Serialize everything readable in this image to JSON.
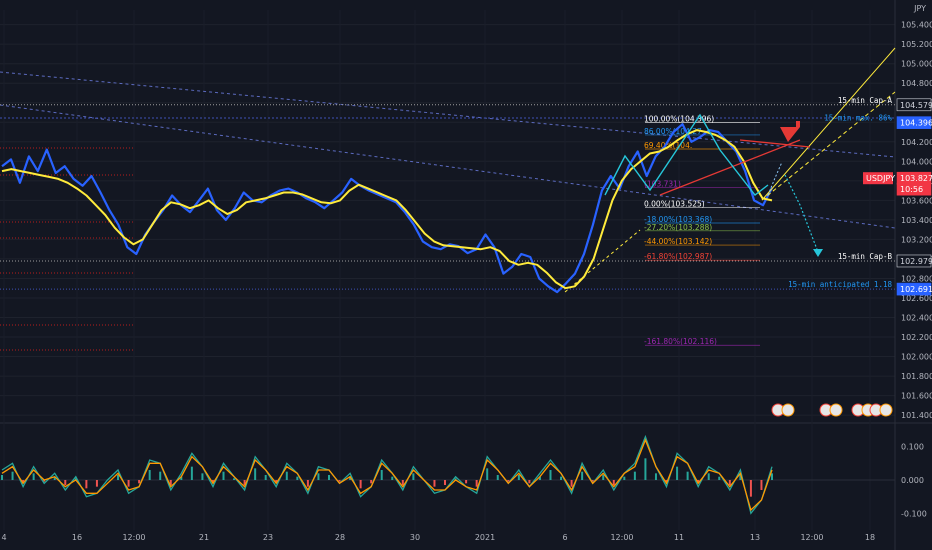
{
  "currency": "JPY",
  "colors": {
    "background": "#131722",
    "price_line": "#2962ff",
    "ma_line": "#ffeb3b",
    "fib_line": "#ffffff",
    "cap_line": "#ffeb3b",
    "arrow": "#e53935",
    "pattern": "#26c6da",
    "osc_a": "#26a69a",
    "osc_b": "#ff9800",
    "hist_pos": "#26a69a",
    "hist_neg": "#ef5350"
  },
  "price_tags": [
    {
      "label": "104.579",
      "value": 104.579,
      "bg": "#131722",
      "fg": "#d1d4dc"
    },
    {
      "label": "104.396",
      "value": 104.396,
      "bg": "#2962ff",
      "fg": "#ffffff"
    },
    {
      "label": "103.827",
      "value": 103.827,
      "bg": "#f23645",
      "fg": "#ffffff"
    },
    {
      "label": "10:56",
      "value": 103.7,
      "bg": "#f23645",
      "fg": "#ffffff"
    },
    {
      "label": "102.979",
      "value": 102.979,
      "bg": "#131722",
      "fg": "#d1d4dc"
    },
    {
      "label": "102.691",
      "value": 102.691,
      "bg": "#2962ff",
      "fg": "#ffffff"
    }
  ],
  "symbol_tag": "USDJPY",
  "annotations": [
    {
      "text": "15-min Cap-A",
      "value": 104.579,
      "color": "#ffffff"
    },
    {
      "text": "15-min max. 86%",
      "value": 104.396,
      "color": "#2196f3"
    },
    {
      "text": "15-min Cap-B",
      "value": 102.979,
      "color": "#ffffff"
    },
    {
      "text": "15-min anticipated 1.18",
      "value": 102.691,
      "color": "#2196f3"
    }
  ],
  "fib_levels": [
    {
      "label": "100.00%(104.396)",
      "value": 104.396,
      "color": "#ffffff"
    },
    {
      "label": "86.00%(104.27",
      "value": 104.27,
      "color": "#2196f3"
    },
    {
      "label": "69.40%(104.",
      "value": 104.126,
      "color": "#ff9800"
    },
    {
      "label": "(103.731)",
      "value": 103.731,
      "color": "#9c27b0"
    },
    {
      "label": "0.00%(103.525)",
      "value": 103.525,
      "color": "#ffffff"
    },
    {
      "label": "-18.00%(103.368)",
      "value": 103.368,
      "color": "#2196f3"
    },
    {
      "label": "-27.20%(103.288)",
      "value": 103.288,
      "color": "#8bc34a"
    },
    {
      "label": "-44.00%(103.142)",
      "value": 103.142,
      "color": "#ff9800"
    },
    {
      "label": "-61.80%(102.987)",
      "value": 102.987,
      "color": "#f44336"
    },
    {
      "label": "-161.80%(102.116)",
      "value": 102.116,
      "color": "#9c27b0"
    }
  ],
  "chart_data": [
    {
      "type": "line",
      "title": "",
      "xlabel": "",
      "ylabel": "",
      "x_ticks": [
        "4",
        "16",
        "12:00",
        "21",
        "23",
        "28",
        "30",
        "2021",
        "6",
        "12:00",
        "11",
        "13",
        "12:00",
        "18"
      ],
      "y_ticks": [
        "105.400",
        "105.200",
        "105.000",
        "104.800",
        "104.600",
        "104.400",
        "104.200",
        "104.000",
        "103.800",
        "103.600",
        "103.400",
        "103.200",
        "103.000",
        "102.800",
        "102.600",
        "102.400",
        "102.200",
        "102.000",
        "101.800",
        "101.600",
        "101.400"
      ],
      "ylim": [
        101.35,
        105.55
      ],
      "grid": true,
      "series": [
        {
          "values": [
            103.95,
            104.02,
            103.78,
            104.05,
            103.9,
            104.12,
            103.88,
            103.95,
            103.82,
            103.75,
            103.85,
            103.68,
            103.5,
            103.35,
            103.12,
            103.05,
            103.25,
            103.38,
            103.5,
            103.65,
            103.55,
            103.48,
            103.6,
            103.72,
            103.5,
            103.4,
            103.52,
            103.68,
            103.6,
            103.58,
            103.65,
            103.7,
            103.72,
            103.68,
            103.62,
            103.58,
            103.52,
            103.6,
            103.68,
            103.82,
            103.75,
            103.7,
            103.66,
            103.62,
            103.58,
            103.48,
            103.35,
            103.18,
            103.12,
            103.1,
            103.15,
            103.13,
            103.06,
            103.1,
            103.25,
            103.12,
            102.85,
            102.92,
            103.05,
            103.02,
            102.8,
            102.72,
            102.66,
            102.75,
            102.85,
            103.05,
            103.35,
            103.7,
            103.85,
            103.72,
            103.95,
            104.1,
            103.85,
            104.05,
            104.15,
            104.3,
            104.38,
            104.2,
            104.25,
            104.32,
            104.3,
            104.2,
            104.1,
            103.9,
            103.6,
            103.55,
            103.73
          ]
        },
        {
          "values": [
            103.9,
            103.92,
            103.9,
            103.88,
            103.86,
            103.84,
            103.82,
            103.78,
            103.72,
            103.65,
            103.55,
            103.45,
            103.32,
            103.22,
            103.15,
            103.2,
            103.35,
            103.5,
            103.58,
            103.56,
            103.52,
            103.55,
            103.6,
            103.52,
            103.46,
            103.5,
            103.58,
            103.6,
            103.62,
            103.65,
            103.68,
            103.68,
            103.66,
            103.62,
            103.58,
            103.57,
            103.6,
            103.7,
            103.76,
            103.72,
            103.68,
            103.64,
            103.6,
            103.5,
            103.38,
            103.26,
            103.18,
            103.14,
            103.13,
            103.12,
            103.11,
            103.1,
            103.12,
            103.08,
            102.98,
            102.94,
            102.96,
            102.94,
            102.86,
            102.76,
            102.7,
            102.72,
            102.82,
            103.0,
            103.3,
            103.6,
            103.8,
            103.92,
            104.0,
            104.08,
            104.1,
            104.15,
            104.22,
            104.28,
            104.32,
            104.3,
            104.27,
            104.22,
            104.15,
            104.0,
            103.78,
            103.62,
            103.6
          ]
        }
      ]
    },
    {
      "type": "line",
      "title": "",
      "y_ticks": [
        "0.100",
        "0.000",
        "-0.100"
      ],
      "ylim": [
        -0.15,
        0.15
      ],
      "series": [
        {
          "values": [
            0.03,
            0.05,
            -0.02,
            0.04,
            -0.01,
            0.02,
            -0.03,
            0.01,
            -0.05,
            -0.04,
            0.0,
            0.03,
            -0.04,
            -0.02,
            0.06,
            0.05,
            -0.03,
            0.02,
            0.08,
            0.04,
            -0.02,
            0.05,
            0.01,
            -0.03,
            0.07,
            0.03,
            -0.02,
            0.05,
            0.02,
            -0.04,
            0.04,
            0.03,
            -0.01,
            0.02,
            -0.05,
            -0.02,
            0.06,
            0.02,
            -0.03,
            0.04,
            0.0,
            -0.04,
            -0.03,
            0.01,
            -0.02,
            -0.04,
            0.07,
            0.03,
            -0.01,
            0.03,
            -0.02,
            0.02,
            0.06,
            0.02,
            -0.04,
            0.05,
            -0.01,
            0.03,
            -0.03,
            0.02,
            0.05,
            0.13,
            0.04,
            -0.02,
            0.08,
            0.05,
            -0.02,
            0.04,
            0.02,
            -0.03,
            0.03,
            -0.1,
            -0.06,
            0.04
          ]
        },
        {
          "values": [
            0.02,
            0.04,
            -0.01,
            0.03,
            0.0,
            0.01,
            -0.02,
            0.0,
            -0.04,
            -0.04,
            -0.01,
            0.02,
            -0.03,
            -0.02,
            0.05,
            0.05,
            -0.02,
            0.01,
            0.07,
            0.04,
            -0.01,
            0.04,
            0.01,
            -0.02,
            0.06,
            0.03,
            -0.01,
            0.04,
            0.02,
            -0.03,
            0.03,
            0.03,
            -0.01,
            0.01,
            -0.04,
            -0.02,
            0.05,
            0.02,
            -0.02,
            0.03,
            0.0,
            -0.03,
            -0.03,
            0.0,
            -0.02,
            -0.03,
            0.06,
            0.03,
            -0.01,
            0.02,
            -0.02,
            0.01,
            0.05,
            0.02,
            -0.03,
            0.04,
            -0.01,
            0.02,
            -0.02,
            0.02,
            0.04,
            0.12,
            0.04,
            -0.01,
            0.07,
            0.05,
            -0.01,
            0.03,
            0.02,
            -0.02,
            0.02,
            -0.09,
            -0.06,
            0.03
          ]
        }
      ]
    }
  ]
}
